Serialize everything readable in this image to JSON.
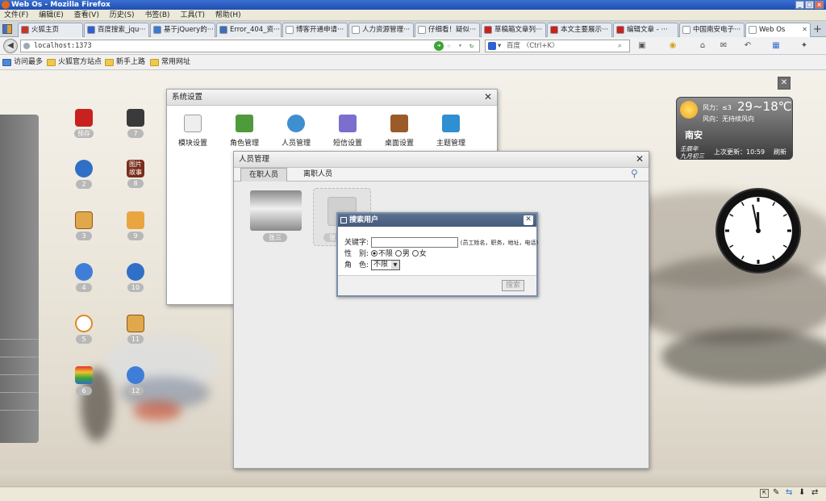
{
  "window": {
    "title": "Web Os - Mozilla Firefox",
    "min": "_",
    "max": "□",
    "close": "×"
  },
  "menu": [
    "文件(F)",
    "编辑(E)",
    "查看(V)",
    "历史(S)",
    "书签(B)",
    "工具(T)",
    "帮助(H)"
  ],
  "tabs": [
    {
      "label": "火狐主页",
      "color": "#c8362a"
    },
    {
      "label": "百度搜索_jqu···",
      "color": "#2f5fd0"
    },
    {
      "label": "基于jQuery的···",
      "color": "#3c7bd2"
    },
    {
      "label": "Error_404_资···",
      "color": "#3b6fb8"
    },
    {
      "label": "博客开通申请···",
      "color": "#ffffff"
    },
    {
      "label": "人力资源管理···",
      "color": "#ffffff"
    },
    {
      "label": "仔细看！疑似···",
      "color": "#ffffff"
    },
    {
      "label": "草稿箱文章列···",
      "color": "#c8211e"
    },
    {
      "label": "本文主要展示···",
      "color": "#c8211e"
    },
    {
      "label": "编辑文章 - ···",
      "color": "#c8211e"
    },
    {
      "label": "中国南安电子···",
      "color": "#ffffff"
    },
    {
      "label": "Web Os",
      "color": "#ffffff"
    }
  ],
  "new_tab": "+",
  "nav": {
    "url": "localhost:1373",
    "search_placeholder": "百度 〈Ctrl+K〉"
  },
  "bookmarks": [
    "访问最多",
    "火狐官方站点",
    "新手上路",
    "常用网址"
  ],
  "desktop_icons": [
    {
      "label": "预存",
      "color": "#c8211e"
    },
    {
      "label": "7",
      "color": "#3a3a3a"
    },
    {
      "label": "2",
      "color": "#2f6fc6"
    },
    {
      "label": "图片\n故事",
      "color": "#7a2d1c"
    },
    {
      "label": "3",
      "color": "#e0a84a"
    },
    {
      "label": "9",
      "color": "#e9a640"
    },
    {
      "label": "4",
      "color": "#3f7ed8"
    },
    {
      "label": "10",
      "color": "#2f6fc6"
    },
    {
      "label": "5",
      "color": "#e08a20"
    },
    {
      "label": "11",
      "color": "#e0a84a"
    },
    {
      "label": "6",
      "color": "#6a4fcf"
    },
    {
      "label": "12",
      "color": "#3f7ed8"
    }
  ],
  "weather": {
    "wind": "风力：≤3",
    "temp": "29~18℃",
    "wind_dir": "风向：无持续风向",
    "city": "南安",
    "lunar1": "壬辰年",
    "lunar2": "九月初三",
    "updated": "上次更新：10:59",
    "refresh": "刷新"
  },
  "clock": {
    "hour": 11,
    "minute": 58
  },
  "sys_window": {
    "title": "系统设置",
    "tools": [
      {
        "label": "模块设置",
        "color": "#9d9d9d"
      },
      {
        "label": "角色管理",
        "color": "#4f9a3a"
      },
      {
        "label": "人员管理",
        "color": "#3f8ed0"
      },
      {
        "label": "短信设置",
        "color": "#7a6fcf"
      },
      {
        "label": "桌面设置",
        "color": "#9a5a2a"
      },
      {
        "label": "主题管理",
        "color": "#2f8fd0"
      }
    ]
  },
  "person_window": {
    "title": "人员管理",
    "tabs": [
      "在职人员",
      "离职人员"
    ],
    "cards": [
      {
        "label": "张三"
      },
      {
        "label": "张···"
      }
    ]
  },
  "search_dialog": {
    "title": "搜索用户",
    "keyword_label": "关键字:",
    "keyword_hint": "(员工姓名，职务，地址，电话)",
    "gender_label": "性　别:",
    "gender_options": [
      "不限",
      "男",
      "女"
    ],
    "role_label": "角　色:",
    "role_value": "不限",
    "search_button": "搜索"
  }
}
